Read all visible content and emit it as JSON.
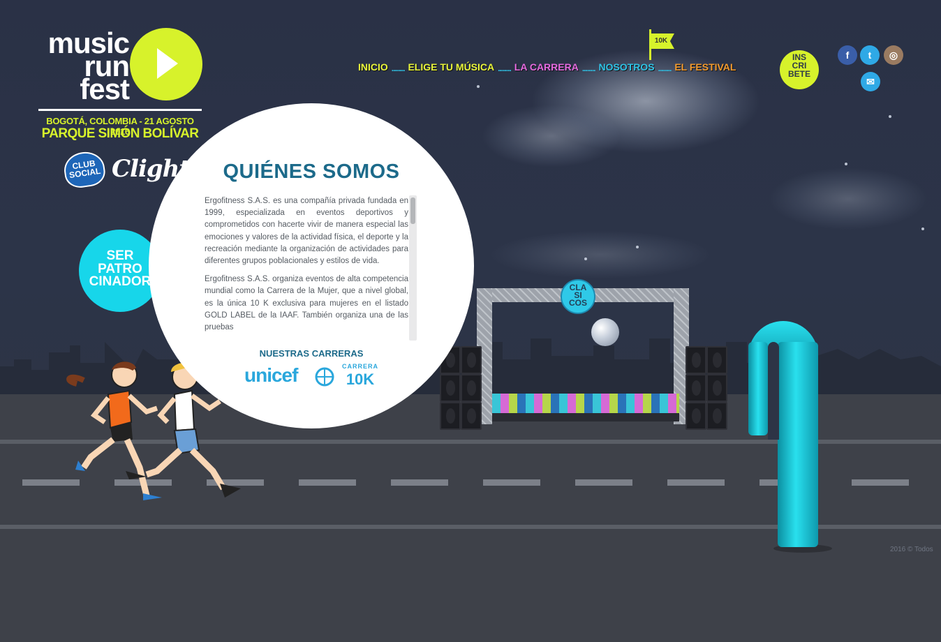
{
  "logo": {
    "line1": "music",
    "line2": "run",
    "line3": "fest",
    "play_icon": "play-icon",
    "date": "BOGOTÁ, COLOMBIA - 21 AGOSTO 2016",
    "place": "PARQUE SIMÓN BOLÍVAR"
  },
  "sponsors": {
    "club_social": "CLUB SOCIAL",
    "clight": "Clight"
  },
  "nav": {
    "items": [
      {
        "label": "INICIO",
        "color": "#e8f53a"
      },
      {
        "label": "ELIGE TU MÚSICA",
        "color": "#e8f53a"
      },
      {
        "label": "LA CARRERA",
        "color": "#e46ae0"
      },
      {
        "label": "NOSOTROS",
        "color": "#2fc3e6"
      },
      {
        "label": "EL FESTIVAL",
        "color": "#f29a2e"
      }
    ],
    "separator": "........",
    "flag_label": "10K"
  },
  "inscribete": "INS\nCRI\nBETE",
  "social": {
    "facebook": "f",
    "twitter": "t",
    "instagram": "◎",
    "mail": "✉"
  },
  "panel": {
    "title": "QUIÉNES SOMOS",
    "paragraphs": [
      "Ergofitness S.A.S. es una compañía privada fundada en 1999, especializada en eventos deportivos y comprometidos con hacerte vivir de manera especial las emociones y valores de la actividad física, el deporte y la recreación mediante la organización de actividades para diferentes grupos poblacionales y estilos de vida.",
      "Ergofitness S.A.S. organiza eventos de alta competencia mundial como la Carrera de la Mujer, que a nivel global, es la única 10 K exclusiva para mujeres en el listado GOLD LABEL de la IAAF. También organiza una de las pruebas"
    ],
    "nuestras_carreras": "NUESTRAS CARRERAS",
    "unicef": "unicef",
    "carrera": "CARRERA",
    "ten_k": "10K"
  },
  "patrocinador": "SER\nPATRO\nCINADOR",
  "clasicos": "CLA\nSI\nCOS",
  "copyright": "2016 © Todos",
  "colors": {
    "lime": "#d7f22b",
    "cyan": "#17d6ea",
    "panel_title": "#1c6a8a"
  }
}
